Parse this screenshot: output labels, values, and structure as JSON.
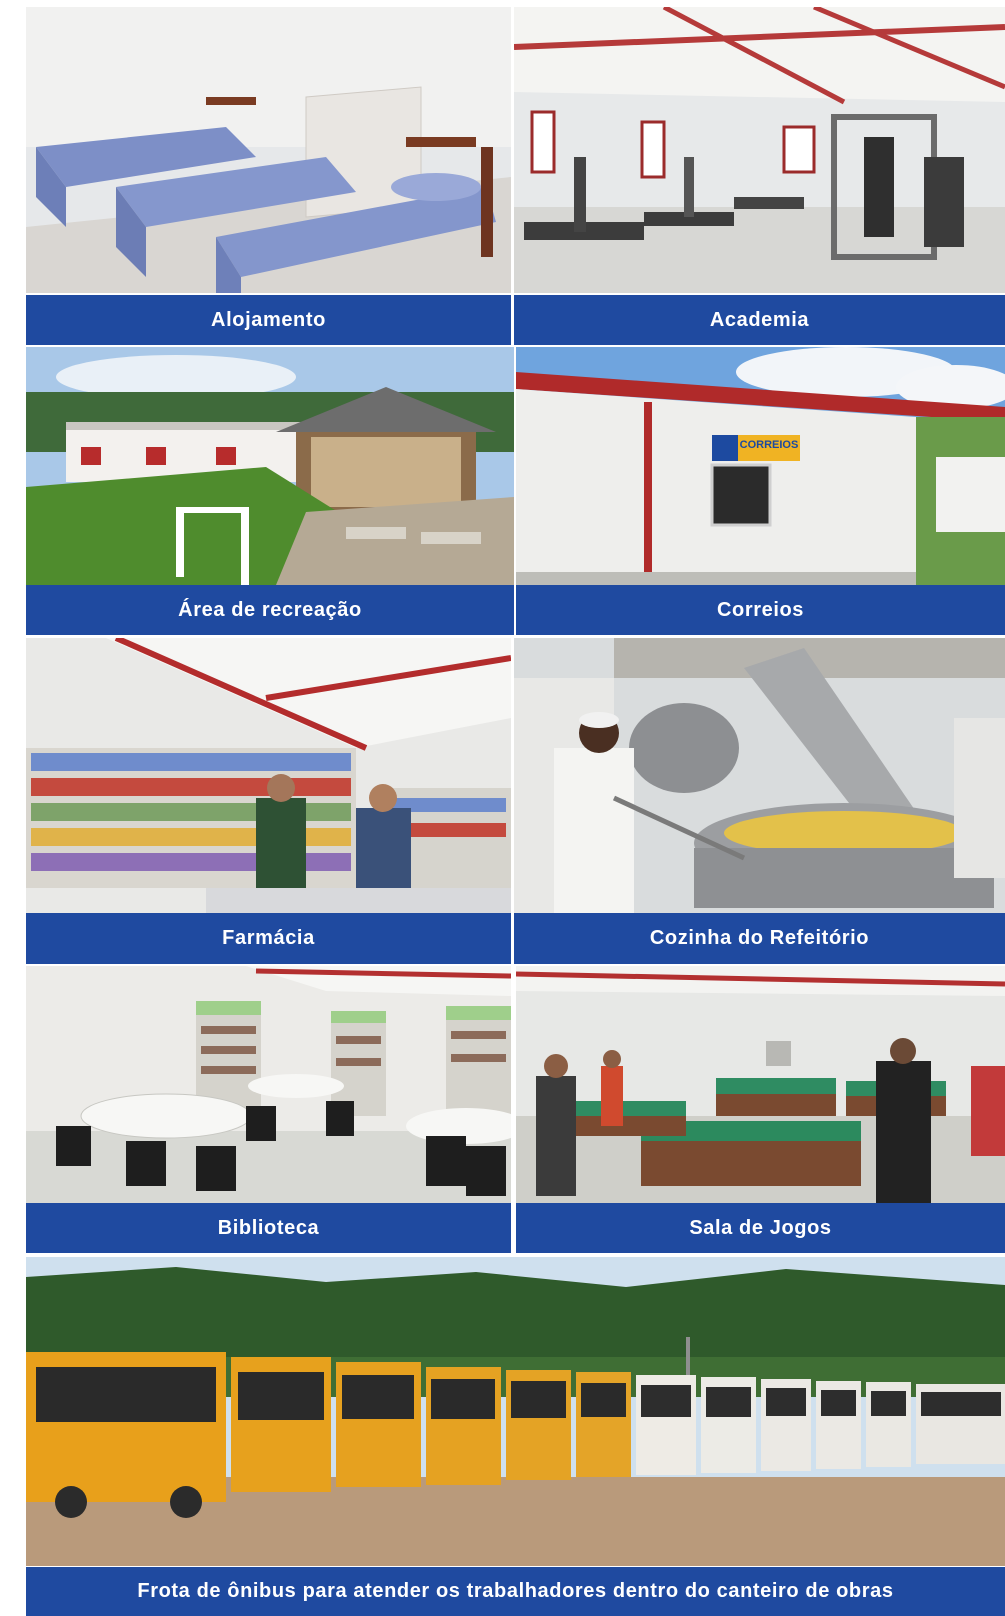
{
  "panels": [
    {
      "caption": "Alojamento",
      "scene": "dormitory-beds"
    },
    {
      "caption": "Academia",
      "scene": "gym"
    },
    {
      "caption": "Área de recreação",
      "scene": "recreation-gazebo"
    },
    {
      "caption": "Correios",
      "scene": "post-office"
    },
    {
      "caption": "Farmácia",
      "scene": "pharmacy"
    },
    {
      "caption": "Cozinha do Refeitório",
      "scene": "kitchen"
    },
    {
      "caption": "Biblioteca",
      "scene": "library"
    },
    {
      "caption": "Sala de Jogos",
      "scene": "game-room"
    },
    {
      "caption": "Frota de ônibus para atender os trabalhadores dentro do canteiro de obras",
      "scene": "bus-fleet"
    }
  ],
  "signs": {
    "correios": "CORREIOS"
  },
  "colors": {
    "caption_bar": "#1f4aa0",
    "caption_text": "#ffffff"
  }
}
